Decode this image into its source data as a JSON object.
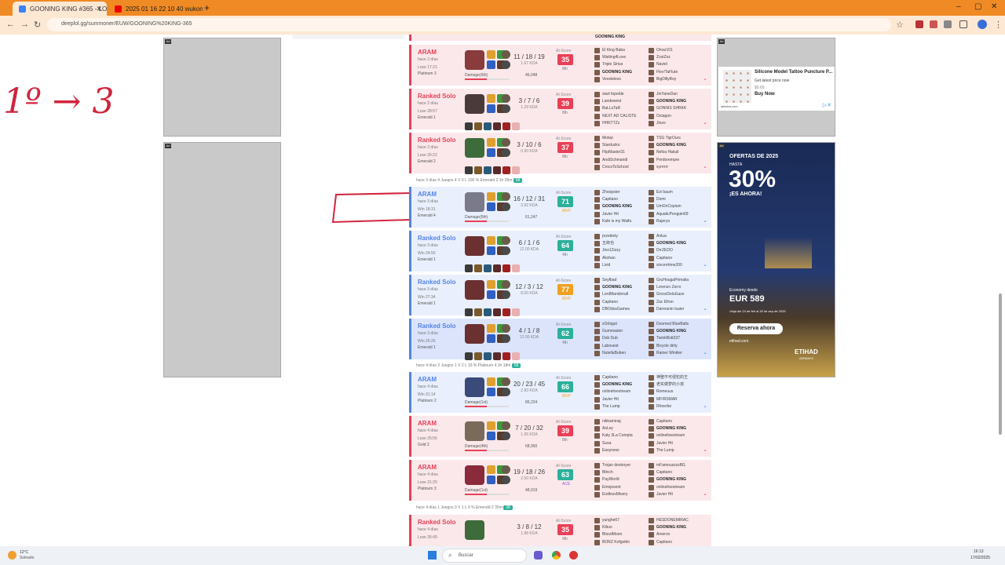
{
  "browser": {
    "tabs": [
      {
        "label": "GOONING KING #365 - LOL Statistics",
        "active": true
      },
      {
        "label": "2025 01 16 22 10 40 wukong sh",
        "active": false
      }
    ],
    "new_tab": "+",
    "url": "deeplol.gg/summoner/EUW/GOONING%20KING-365"
  },
  "annotations": {
    "handwritten": "1º → 3"
  },
  "matches_group1": [
    {
      "mode": "ARAM",
      "ago": "hace 2 días",
      "result": "Lose 17:21",
      "rank": "Platinum 3",
      "kda": "11 / 18 / 19",
      "ratio": "1.67 KDA",
      "damage_label": "Damage(6th)",
      "damage": "46,048",
      "score": "35",
      "place": "8th",
      "blue": false,
      "champ_color": "#8a3b3b",
      "team1": [
        "El King Baba",
        "Waiting4Love",
        "Triple Sirius",
        "GOONING KING",
        "Vexsteless"
      ],
      "team2": [
        "Omar101",
        "ZosiZoz",
        "Naviel",
        "Flex!TaFlute",
        "BigDillyBoy"
      ]
    },
    {
      "mode": "Ranked Solo",
      "ago": "hace 2 días",
      "result": "Lose 28:57",
      "rank": "Emerald 1",
      "kda": "3 / 7 / 6",
      "ratio": "1.29 KDA",
      "damage_label": "",
      "damage": "",
      "score": "39",
      "place": "8th",
      "blue": false,
      "champ_color": "#4a3a3a",
      "team1": [
        "start fopelde",
        "Landewest",
        "BaLLsTaR",
        "NEXT AD CALISTE",
        "HHKTTZz"
      ],
      "team2": [
        "JinYaneDan",
        "GOONING KING",
        "GONNIS SHRKK",
        "Octagon",
        "Jinzo"
      ]
    },
    {
      "mode": "Ranked Solo",
      "ago": "hace 2 días",
      "result": "Lose 26:22",
      "rank": "Emerald 2",
      "kda": "3 / 10 / 6",
      "ratio": "0.90 KDA",
      "damage_label": "",
      "damage": "",
      "score": "37",
      "place": "8th",
      "blue": false,
      "champ_color": "#3d6b3a",
      "team1": [
        "Motep",
        "Starduzko",
        "FlipMaster31",
        "AndiSchmandi",
        "CrocsToSchool"
      ],
      "team2": [
        "TSG TigrOurs",
        "GOONING KING",
        "Nefza Hakuli",
        "Perdorempre",
        "xyrrrrrr"
      ]
    }
  ],
  "sep1": "hace 3 días   4 Juegos   4 V 0 L   100 %   Emerald 2   1h 35m",
  "sep1_badge": "88",
  "matches_group2": [
    {
      "mode": "ARAM",
      "ago": "hace 3 días",
      "result": "Win 18:31",
      "rank": "Emerald 4",
      "kda": "16 / 12 / 31",
      "ratio": "3.92 KDA",
      "damage_label": "Damage(5th)",
      "damage": "61,247",
      "score": "71",
      "place": "MVP",
      "blue": true,
      "sel": false,
      "champ_color": "#7a7a8a",
      "team1": [
        "Zhoopster",
        "Capitano",
        "GOONING KING",
        "Javier Hit",
        "Kafe is my Waifu"
      ],
      "team2": [
        "Ezi baum",
        "Domi",
        "UmOnCopium",
        "AquaticPenguin69",
        "Rajeryo"
      ]
    },
    {
      "mode": "Ranked Solo",
      "ago": "hace 3 días",
      "result": "Win 24:50",
      "rank": "Emerald 1",
      "kda": "6 / 1 / 6",
      "ratio": "12.00 KDA",
      "damage_label": "",
      "damage": "",
      "score": "64",
      "place": "4th",
      "blue": true,
      "sel": false,
      "champ_color": "#6b3030",
      "team1": [
        "przekiety",
        "五郎也",
        "Jinx12izzy",
        "Akshan",
        "Livid"
      ],
      "team2": [
        "Anlua",
        "GOONING KING",
        "DrrZEDO",
        "Capitano",
        "sincerrtime200"
      ]
    },
    {
      "mode": "Ranked Solo",
      "ago": "hace 3 días",
      "result": "Win 27:34",
      "rank": "Emerald 1",
      "kda": "12 / 3 / 12",
      "ratio": "8.00 KDA",
      "damage_label": "",
      "damage": "",
      "score": "77",
      "place": "MVP",
      "blue": true,
      "sel": false,
      "champ_color": "#6b3030",
      "team1": [
        "Seyfbad",
        "GOONING KING",
        "LordMandonall",
        "Capitano",
        "DBOdosGames"
      ],
      "team2": [
        "GruHougaPrimalia",
        "Lorenzo Zorro",
        "GrossDeluGaze",
        "Zac Efron",
        "Darmanin Isaier"
      ]
    },
    {
      "mode": "Ranked Solo",
      "ago": "hace 3 días",
      "result": "Win 26:26",
      "rank": "Emerald 1",
      "kda": "4 / 1 / 8",
      "ratio": "12.00 KDA",
      "damage_label": "",
      "damage": "",
      "score": "62",
      "place": "4th",
      "blue": true,
      "sel": true,
      "champ_color": "#6b3030",
      "team1": [
        "xOrbigot",
        "Gummaster",
        "Dob Dub",
        "Labouest",
        "NutellaBuben"
      ],
      "team2": [
        "Doomed BlueBalls",
        "GOONING KING",
        "TwinkBott337",
        "Bicycle dirty",
        "Rainer Winkler"
      ]
    }
  ],
  "sep2": "hace 4 días   3 Juegos   1 V 2 L   33 %   Platinum 4   1h 18m",
  "sep2_badge": "56",
  "matches_group3": [
    {
      "mode": "ARAM",
      "ago": "hace 4 días",
      "result": "Win 31:14",
      "rank": "Platinum 2",
      "kda": "20 / 23 / 45",
      "ratio": "2.83 KDA",
      "damage_label": "Damage(1st)",
      "damage": "89,224",
      "score": "66",
      "place": "MVP",
      "blue": true,
      "sel": false,
      "champ_color": "#3a4a7a",
      "team1": [
        "Capitano",
        "GOONING KING",
        "onlinelivestream",
        "Javier Hit",
        "The Lump"
      ],
      "team2": [
        "神聖不可侵犯的王",
        "老实做梦的小孩",
        "Romeuus",
        "MFIRSMAR",
        "Rhoerbe"
      ]
    },
    {
      "mode": "ARAM",
      "ago": "hace 4 días",
      "result": "Lose 25:56",
      "rank": "Gold 2",
      "kda": "7 / 20 / 32",
      "ratio": "1.95 KDA",
      "damage_label": "Damage(4th)",
      "damage": "68,950",
      "score": "39",
      "place": "8th",
      "blue": false,
      "sel": false,
      "champ_color": "#7a6a5a",
      "team1": [
        "nikkaminaj",
        "AsLey",
        "Katy 3La Compta",
        "Susa",
        "Easyness"
      ],
      "team2": [
        "Capitano",
        "GOONING KING",
        "onlinelivestream",
        "Javier Hit",
        "The Lump"
      ]
    },
    {
      "mode": "ARAM",
      "ago": "hace 4 días",
      "result": "Lose 21:20",
      "rank": "Platinum 3",
      "kda": "19 / 18 / 26",
      "ratio": "2.50 KDA",
      "damage_label": "Damage(1st)",
      "damage": "48,919",
      "score": "63",
      "place": "ACE",
      "blue": false,
      "sel": false,
      "champ_color": "#8a2a3a",
      "team1": [
        "Trojan destroyer",
        "Blinch",
        "PayWorld",
        "Emojesent",
        "EndlessMisery"
      ],
      "team2": [
        "mFamouszzzBG",
        "Capitano",
        "GOONING KING",
        "onlinelivestream",
        "Javier Hit"
      ]
    }
  ],
  "sep3": "hace 4 días   1 Juegos   0 V 1 L   0 %   Emerald 2   35m",
  "sep3_badge": "38",
  "match_last": {
    "mode": "Ranked Solo",
    "ago": "hace 4 días",
    "result": "Lose 35:49",
    "rank": "",
    "kda": "3 / 8 / 12",
    "ratio": "1.88 KDA",
    "score": "35",
    "place": "9th",
    "blue": false,
    "team1": [
      "yunghe67",
      "Kibuo",
      "BloodMoon",
      "BORZ Kofgoblo"
    ],
    "team2": [
      "HESDONEMIRAC",
      "GOONING KING",
      "Amerox",
      "Capitano"
    ]
  },
  "ai_label": "AI-Score",
  "ad_right1": {
    "title": "Silicone Model Tattoo Puncture P...",
    "sub": "Get latest price now",
    "price": "$0.65",
    "cta": "Buy Now",
    "domain": "alibaba.com"
  },
  "ad_right2": {
    "head": "OFERTAS DE 2025",
    "pre": "HASTA",
    "pct": "30%",
    "pct_suffix": "¡ES AHORA!",
    "eco": "Economy desde",
    "price": "EUR 589",
    "dates": "Viaja del 24 de feb al 30 de sep de 2025",
    "cta": "Reserva ahora",
    "domain": "etihad.com",
    "brand": "ETIHAD",
    "brand_sub": "AIRWAYS"
  },
  "taskbar": {
    "weather": "12°C",
    "weather_sub": "Soleado",
    "search": "Buscar",
    "time": "16:13",
    "date": "17/02/2025"
  }
}
